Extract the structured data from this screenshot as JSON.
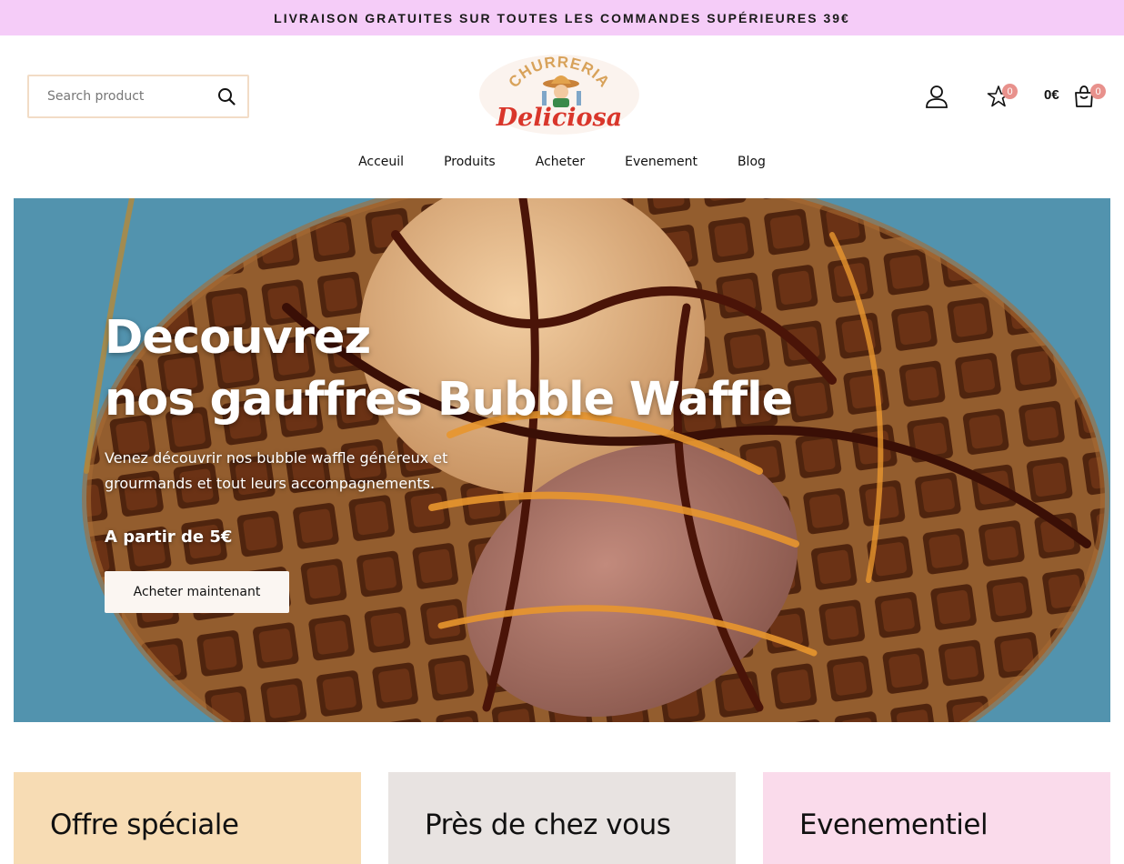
{
  "promo": {
    "text": "LIVRAISON GRATUITES SUR TOUTES LES COMMANDES SUPÉRIEURES 39€"
  },
  "search": {
    "placeholder": "Search product",
    "value": ""
  },
  "logo": {
    "top_text": "CHURRERIA",
    "bottom_text": "Deliciosa"
  },
  "header": {
    "wishlist_count": "0",
    "cart_total": "0€",
    "cart_count": "0"
  },
  "nav": {
    "items": [
      {
        "label": "Acceuil"
      },
      {
        "label": "Produits"
      },
      {
        "label": "Acheter"
      },
      {
        "label": "Evenement"
      },
      {
        "label": "Blog"
      }
    ]
  },
  "hero": {
    "title_line1": "Decouvrez",
    "title_line2": "nos gauffres Bubble Waffle",
    "description": "Venez découvrir nos bubble waffle généreux et grourmands et tout leurs accompagnements.",
    "price": "A partir de 5€",
    "cta_label": "Acheter maintenant"
  },
  "cards": [
    {
      "title": "Offre spéciale",
      "color": "#f7dcb4"
    },
    {
      "title": "Près de chez vous",
      "color": "#e8e3e1"
    },
    {
      "title": "Evenementiel",
      "color": "#fadbeb"
    }
  ],
  "colors": {
    "promo_bg": "#f5ccf8",
    "badge": "#e8918c",
    "logo_red": "#d9362b",
    "logo_tan": "#d8a25a"
  }
}
